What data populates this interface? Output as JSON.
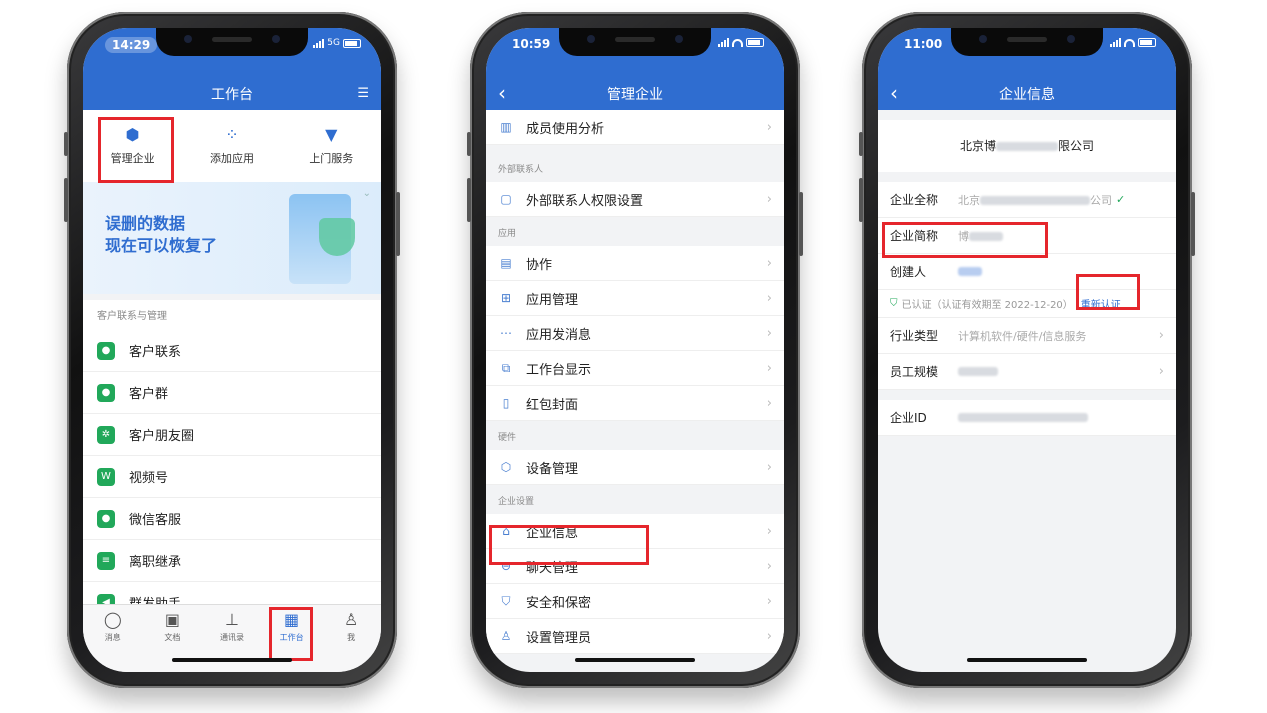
{
  "phone1": {
    "status_time": "14:29",
    "network": "5G",
    "title": "工作台",
    "quick_actions": [
      {
        "label": "管理企业",
        "icon": "hexagon-icon"
      },
      {
        "label": "添加应用",
        "icon": "apps-grid-icon"
      },
      {
        "label": "上门服务",
        "icon": "tie-icon"
      }
    ],
    "banner": {
      "line1": "误删的数据",
      "line2": "现在可以恢复了"
    },
    "section": "客户联系与管理",
    "items": [
      "客户联系",
      "客户群",
      "客户朋友圈",
      "视频号",
      "微信客服",
      "离职继承",
      "群发助手"
    ],
    "tabs": [
      {
        "label": "消息",
        "icon": "chat-bubble-icon"
      },
      {
        "label": "文档",
        "icon": "document-icon"
      },
      {
        "label": "通讯录",
        "icon": "org-chart-icon"
      },
      {
        "label": "工作台",
        "icon": "workbench-grid-icon"
      },
      {
        "label": "我",
        "icon": "person-icon"
      }
    ]
  },
  "phone2": {
    "status_time": "10:59",
    "title": "管理企业",
    "top_item": "成员使用分析",
    "groups": [
      {
        "label": "外部联系人",
        "items": [
          "外部联系人权限设置"
        ]
      },
      {
        "label": "应用",
        "items": [
          "协作",
          "应用管理",
          "应用发消息",
          "工作台显示",
          "红包封面"
        ]
      },
      {
        "label": "硬件",
        "items": [
          "设备管理"
        ]
      },
      {
        "label": "企业设置",
        "items": [
          "企业信息",
          "聊天管理",
          "安全和保密",
          "设置管理员"
        ]
      }
    ]
  },
  "phone3": {
    "status_time": "11:00",
    "title": "企业信息",
    "company_prefix": "北京博",
    "company_suffix": "限公司",
    "full_name_label": "企业全称",
    "full_name_prefix": "北京",
    "full_name_suffix": "公司",
    "short_name_label": "企业简称",
    "short_name_value": "博",
    "creator_label": "创建人",
    "cert_text": "已认证（认证有效期至 2022-12-20）",
    "recert_label": "重新认证",
    "industry_label": "行业类型",
    "industry_value": "计算机软件/硬件/信息服务",
    "size_label": "员工规模",
    "id_label": "企业ID"
  },
  "colors": {
    "brand_blue": "#2f6dd0",
    "highlight_red": "#e5262c",
    "green": "#21a85a"
  }
}
